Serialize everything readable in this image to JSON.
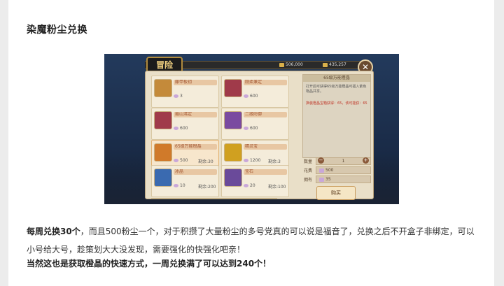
{
  "article": {
    "heading": "染魔粉尘兑换",
    "para1_bold": "每周兑换30个",
    "para1_rest": "，而且500粉尘一个，对于积攒了大量粉尘的多号党真的可以说是福音了，兑换之后不开盒子非绑定，可以小号给大号，趁策划大大没发现，需要强化的快强化吧亲！",
    "para2": "当然这也是获取橙晶的快速方式，一周兑换满了可以达到240个！"
  },
  "game": {
    "logo": "冒险",
    "currency1": "506,000",
    "currency2": "435,257",
    "close": "✕",
    "items": [
      {
        "name": "藤甲板钥",
        "price": "3",
        "remain": "",
        "color": "#c48a3a"
      },
      {
        "name": "刚柔兼定",
        "price": "600",
        "remain": "",
        "color": "#a03a4a"
      },
      {
        "name": "霸山沸定",
        "price": "600",
        "remain": "",
        "color": "#a03a4a"
      },
      {
        "name": "二级防御",
        "price": "600",
        "remain": "",
        "color": "#7a4aa0"
      },
      {
        "name": "65级万能橙晶",
        "price": "500",
        "remain": "剩余:30",
        "color": "#d07a2a"
      },
      {
        "name": "精灵宝",
        "price": "1200",
        "remain": "剩余:3",
        "color": "#d0a020"
      },
      {
        "name": "冰晶",
        "price": "10",
        "remain": "剩余:200",
        "color": "#3a6ab0"
      },
      {
        "name": "宝石",
        "price": "20",
        "remain": "剩余:100",
        "color": "#6a4a9a"
      }
    ],
    "detail_title": "65级万能橙晶",
    "detail_desc": "打开后可获得65级万能橙晶可插入紫色物品共享。",
    "detail_attr": "换装橙晶宝箱获得：65，该可能获：65",
    "qty_label": "数量",
    "qty_value": "1",
    "cost_label": "花费",
    "cost_value": "500",
    "own_label": "拥有",
    "own_value": "35",
    "buy_label": "购买"
  }
}
